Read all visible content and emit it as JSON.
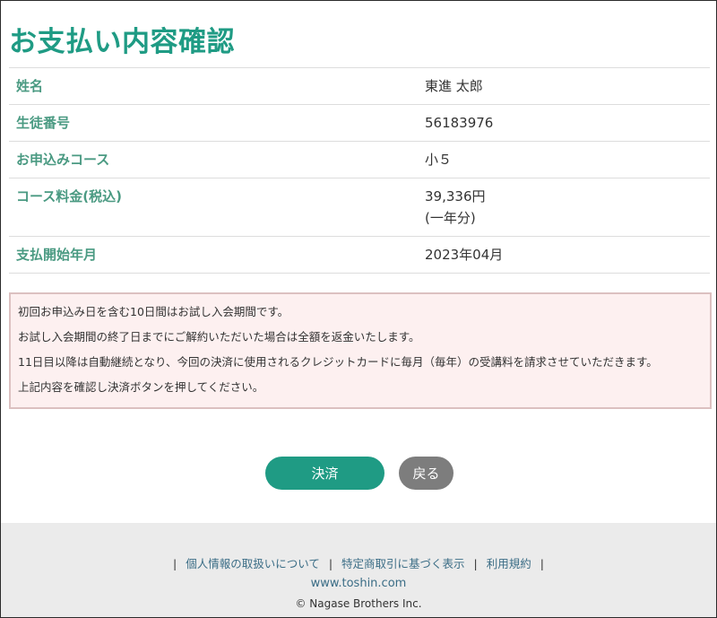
{
  "page": {
    "title": "お支払い内容確認"
  },
  "details": [
    {
      "label": "姓名",
      "value": "東進 太郎"
    },
    {
      "label": "生徒番号",
      "value": "56183976"
    },
    {
      "label": "お申込みコース",
      "value": "小５"
    },
    {
      "label": "コース料金(税込)",
      "value": "39,336円",
      "value2": "(一年分)"
    },
    {
      "label": "支払開始年月",
      "value": "2023年04月"
    }
  ],
  "notice": {
    "lines": [
      "初回お申込み日を含む10日間はお試し入会期間です。",
      "お試し入会期間の終了日までにご解約いただいた場合は全額を返金いたします。",
      "11日目以降は自動継続となり、今回の決済に使用されるクレジットカードに毎月（毎年）の受講料を請求させていただきます。",
      "上記内容を確認し決済ボタンを押してください。"
    ]
  },
  "buttons": {
    "pay_label": "決済",
    "back_label": "戻る"
  },
  "footer": {
    "separator": "|",
    "links": [
      "個人情報の取扱いについて",
      "特定商取引に基づく表示",
      "利用規約"
    ],
    "site_url": "www.toshin.com",
    "copyright": "© Nagase Brothers Inc."
  },
  "colors": {
    "accent": "#1f9b84",
    "label_green": "#4a9a82",
    "notice_bg": "#fdf0f0",
    "back_button": "#7d7d7d",
    "footer_bg": "#ebebeb",
    "link": "#3b6d86"
  }
}
